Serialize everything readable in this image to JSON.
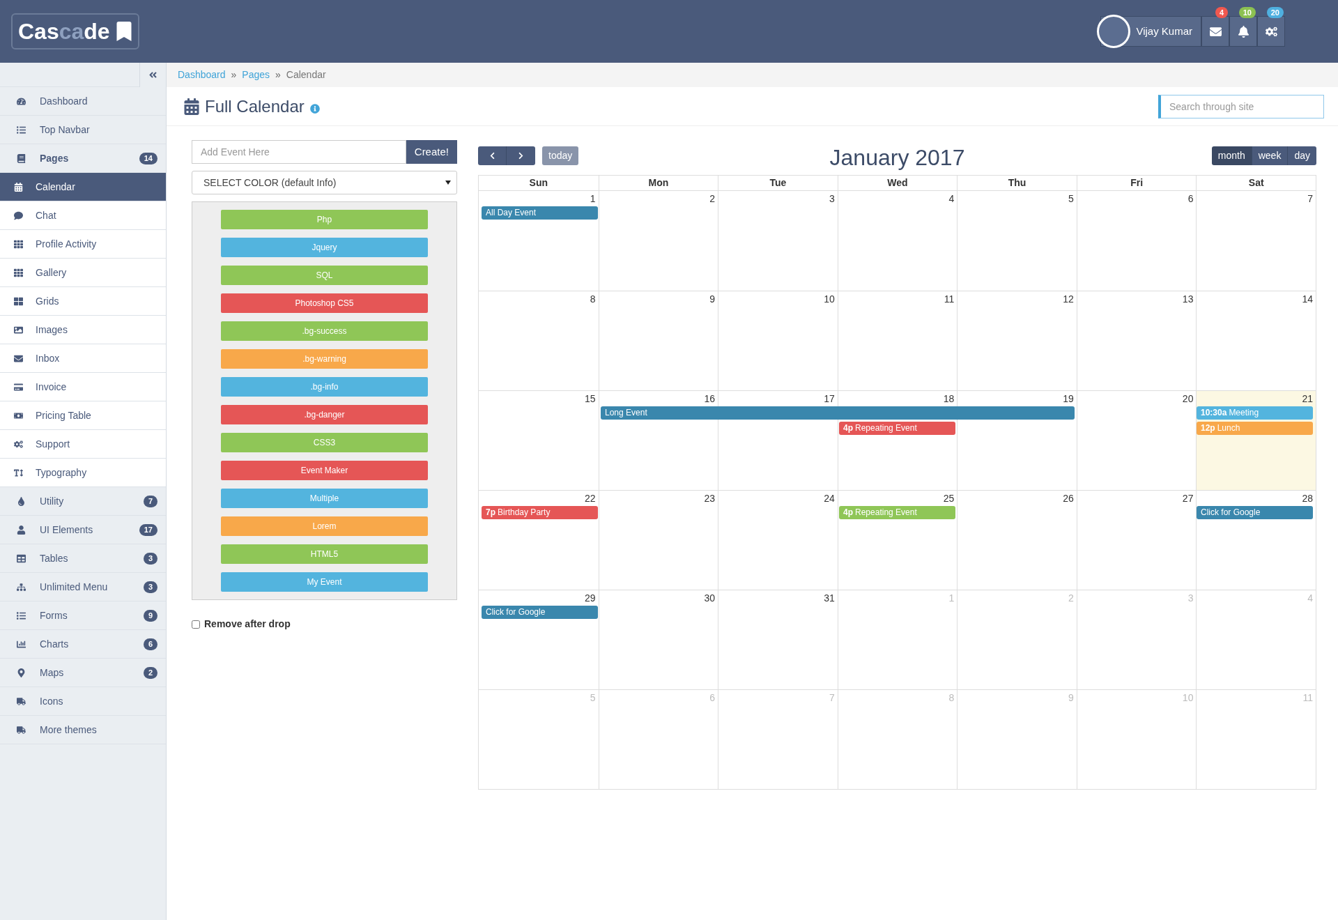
{
  "header": {
    "logo": {
      "prefix": "Cas",
      "highlight": "ca",
      "suffix": "de"
    },
    "user_name": "Vijay Kumar",
    "icon_buttons": [
      {
        "badge": "4",
        "color": "#f0584f"
      },
      {
        "badge": "10",
        "color": "#8cc152"
      },
      {
        "badge": "20",
        "color": "#4fb0e0"
      }
    ]
  },
  "sidebar": {
    "items": [
      {
        "label": "Dashboard",
        "selected": false
      },
      {
        "label": "Top Navbar",
        "selected": false
      },
      {
        "label": "Pages",
        "badge": "14",
        "selected": false,
        "expanded": true,
        "children": [
          {
            "label": "Calendar",
            "selected": true
          },
          {
            "label": "Chat",
            "selected": false
          },
          {
            "label": "Profile Activity",
            "selected": false
          },
          {
            "label": "Gallery",
            "selected": false
          },
          {
            "label": "Grids",
            "selected": false
          },
          {
            "label": "Images",
            "selected": false
          },
          {
            "label": "Inbox",
            "selected": false
          },
          {
            "label": "Invoice",
            "selected": false
          },
          {
            "label": "Pricing Table",
            "selected": false
          },
          {
            "label": "Support",
            "selected": false
          },
          {
            "label": "Typography",
            "selected": false
          }
        ]
      },
      {
        "label": "Utility",
        "badge": "7",
        "selected": false
      },
      {
        "label": "UI Elements",
        "badge": "17",
        "selected": false
      },
      {
        "label": "Tables",
        "badge": "3",
        "selected": false
      },
      {
        "label": "Unlimited Menu",
        "badge": "3",
        "selected": false
      },
      {
        "label": "Forms",
        "badge": "9",
        "selected": false
      },
      {
        "label": "Charts",
        "badge": "6",
        "selected": false
      },
      {
        "label": "Maps",
        "badge": "2",
        "selected": false
      },
      {
        "label": "Icons",
        "selected": false
      },
      {
        "label": "More themes",
        "selected": false
      }
    ]
  },
  "breadcrumb": {
    "separator": "»",
    "items": [
      "Dashboard",
      "Pages",
      "Calendar"
    ]
  },
  "search": {
    "placeholder": "Search through site"
  },
  "page_title": "Full Calendar",
  "event_form": {
    "placeholder": "Add Event Here",
    "button": "Create!",
    "color_select": "SELECT COLOR (default Info)",
    "remove_after_drop": {
      "label": "Remove after drop",
      "checked": false
    }
  },
  "external_events": [
    {
      "label": "Php",
      "color": "#8fc657"
    },
    {
      "label": "Jquery",
      "color": "#53b4de"
    },
    {
      "label": "SQL",
      "color": "#8fc657"
    },
    {
      "label": "Photoshop CS5",
      "color": "#e55656"
    },
    {
      "label": ".bg-success",
      "color": "#8fc657"
    },
    {
      "label": ".bg-warning",
      "color": "#f8a84a"
    },
    {
      "label": ".bg-info",
      "color": "#53b4de"
    },
    {
      "label": ".bg-danger",
      "color": "#e55656"
    },
    {
      "label": "CSS3",
      "color": "#8fc657"
    },
    {
      "label": "Event Maker",
      "color": "#e55656"
    },
    {
      "label": "Multiple",
      "color": "#53b4de"
    },
    {
      "label": "Lorem",
      "color": "#f8a84a"
    },
    {
      "label": "HTML5",
      "color": "#8fc657"
    },
    {
      "label": "My Event",
      "color": "#53b4de"
    }
  ],
  "calendar": {
    "title": "January 2017",
    "today_button": "today",
    "views": [
      {
        "label": "month",
        "selected": true
      },
      {
        "label": "week",
        "selected": false
      },
      {
        "label": "day",
        "selected": false
      }
    ],
    "weekdays": [
      "Sun",
      "Mon",
      "Tue",
      "Wed",
      "Thu",
      "Fri",
      "Sat"
    ],
    "weeks": [
      {
        "days": [
          {
            "n": "1",
            "other": false,
            "today": false,
            "events": [
              {
                "kind": "event",
                "title": "All Day Event",
                "color": "#3a87ad"
              }
            ]
          },
          {
            "n": "2",
            "other": false,
            "today": false
          },
          {
            "n": "3",
            "other": false,
            "today": false
          },
          {
            "n": "4",
            "other": false,
            "today": false
          },
          {
            "n": "5",
            "other": false,
            "today": false
          },
          {
            "n": "6",
            "other": false,
            "today": false
          },
          {
            "n": "7",
            "other": false,
            "today": false
          }
        ]
      },
      {
        "days": [
          {
            "n": "8",
            "other": false,
            "today": false
          },
          {
            "n": "9",
            "other": false,
            "today": false
          },
          {
            "n": "10",
            "other": false,
            "today": false
          },
          {
            "n": "11",
            "other": false,
            "today": false
          },
          {
            "n": "12",
            "other": false,
            "today": false
          },
          {
            "n": "13",
            "other": false,
            "today": false
          },
          {
            "n": "14",
            "other": false,
            "today": false
          }
        ]
      },
      {
        "days": [
          {
            "n": "15",
            "other": false,
            "today": false
          },
          {
            "n": "16",
            "other": false,
            "today": false,
            "events": [
              {
                "kind": "event",
                "title": "Long Event",
                "color": "#3a87ad"
              }
            ]
          },
          {
            "n": "17",
            "other": false,
            "today": false,
            "events": [
              {
                "kind": "continuation"
              }
            ]
          },
          {
            "n": "18",
            "other": false,
            "today": false,
            "events": [
              {
                "kind": "continuation"
              },
              {
                "kind": "event",
                "time": "4p",
                "title": "Repeating Event",
                "color": "#e55656"
              }
            ]
          },
          {
            "n": "19",
            "other": false,
            "today": false,
            "events": [
              {
                "kind": "continuation"
              }
            ]
          },
          {
            "n": "20",
            "other": false,
            "today": false
          },
          {
            "n": "21",
            "other": false,
            "today": true,
            "events": [
              {
                "kind": "event",
                "time": "10:30a",
                "title": "Meeting",
                "color": "#53b4de"
              },
              {
                "kind": "event",
                "time": "12p",
                "title": "Lunch",
                "color": "#f8a84a"
              }
            ]
          }
        ]
      },
      {
        "days": [
          {
            "n": "22",
            "other": false,
            "today": false,
            "events": [
              {
                "kind": "event",
                "time": "7p",
                "title": "Birthday Party",
                "color": "#e55656"
              }
            ]
          },
          {
            "n": "23",
            "other": false,
            "today": false
          },
          {
            "n": "24",
            "other": false,
            "today": false
          },
          {
            "n": "25",
            "other": false,
            "today": false,
            "events": [
              {
                "kind": "event",
                "time": "4p",
                "title": "Repeating Event",
                "color": "#8fc657"
              }
            ]
          },
          {
            "n": "26",
            "other": false,
            "today": false
          },
          {
            "n": "27",
            "other": false,
            "today": false
          },
          {
            "n": "28",
            "other": false,
            "today": false,
            "events": [
              {
                "kind": "event",
                "title": "Click for Google",
                "color": "#3a87ad"
              }
            ]
          }
        ]
      },
      {
        "days": [
          {
            "n": "29",
            "other": false,
            "today": false,
            "events": [
              {
                "kind": "event",
                "title": "Click for Google",
                "color": "#3a87ad"
              }
            ]
          },
          {
            "n": "30",
            "other": false,
            "today": false
          },
          {
            "n": "31",
            "other": false,
            "today": false
          },
          {
            "n": "1",
            "other": true,
            "today": false
          },
          {
            "n": "2",
            "other": true,
            "today": false
          },
          {
            "n": "3",
            "other": true,
            "today": false
          },
          {
            "n": "4",
            "other": true,
            "today": false
          }
        ]
      },
      {
        "days": [
          {
            "n": "5",
            "other": true,
            "today": false
          },
          {
            "n": "6",
            "other": true,
            "today": false
          },
          {
            "n": "7",
            "other": true,
            "today": false
          },
          {
            "n": "8",
            "other": true,
            "today": false
          },
          {
            "n": "9",
            "other": true,
            "today": false
          },
          {
            "n": "10",
            "other": true,
            "today": false
          },
          {
            "n": "11",
            "other": true,
            "today": false
          }
        ]
      }
    ]
  }
}
